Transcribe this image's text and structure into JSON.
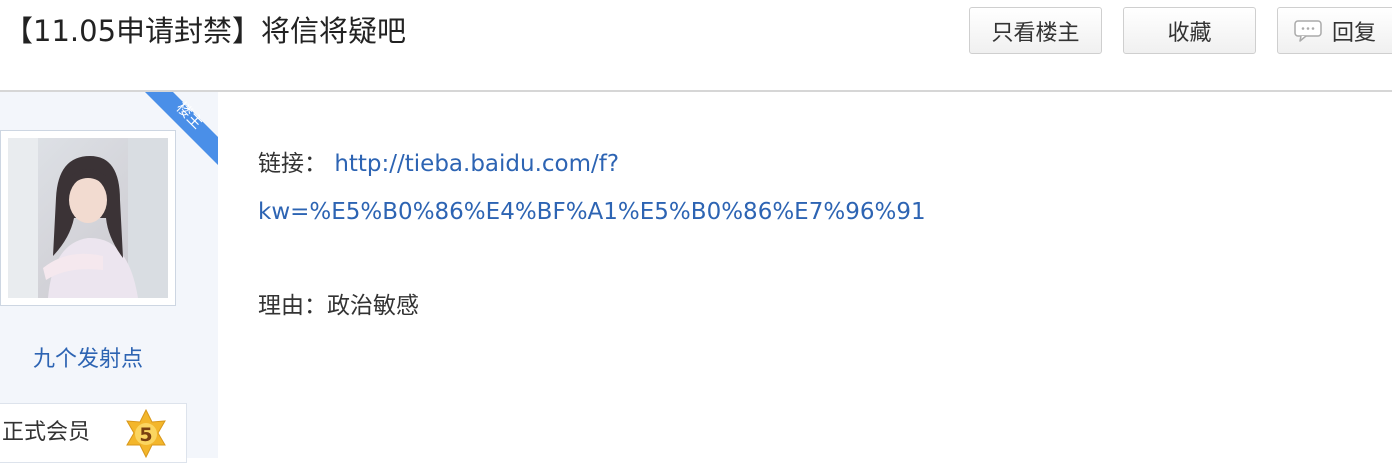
{
  "thread": {
    "title": "【11.05申请封禁】将信将疑吧"
  },
  "actions": {
    "only_louzhu_label": "只看楼主",
    "favorite_label": "收藏",
    "reply_label": "回复",
    "reply_icon": "comment-bubble-icon"
  },
  "author": {
    "badge_label": "楼主",
    "avatar_icon": "user-avatar-photo",
    "name": "九个发射点",
    "level_name": "正式会员",
    "level_number": "5",
    "level_icon": "level-star-icon"
  },
  "post": {
    "link_label": "链接：",
    "link_url_part1": "http://tieba.baidu.com/f?",
    "link_url_part2": "kw=%E5%B0%86%E4%BF%A1%E5%B0%86%E7%96%91",
    "reason_label": "理由：",
    "reason_text": "政治敏感"
  },
  "colors": {
    "link": "#2d64b3",
    "badge": "#4a8fe8",
    "level_star": "#f3b62b",
    "sidebar_bg": "#f3f6fb"
  }
}
